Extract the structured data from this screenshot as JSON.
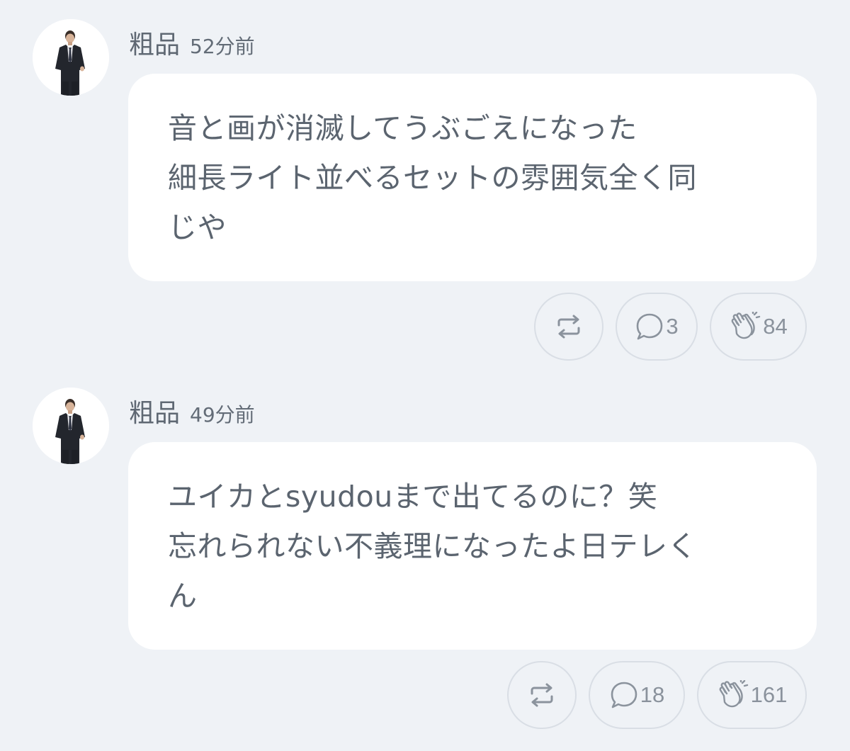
{
  "posts": [
    {
      "author": "粗品",
      "time": "52分前",
      "lines": [
        "音と画が消滅してうぶごえになった",
        "細長ライト並べるセットの雰囲気全く同",
        "じや"
      ],
      "actions": {
        "repost_icon": "repost-icon",
        "reply_icon": "speech-bubble-icon",
        "reply_count": "3",
        "clap_icon": "clap-icon",
        "clap_count": "84"
      }
    },
    {
      "author": "粗品",
      "time": "49分前",
      "lines": [
        "ユイカとsyudouまで出てるのに？笑",
        "忘れられない不義理になったよ日テレく",
        "ん"
      ],
      "actions": {
        "repost_icon": "repost-icon",
        "reply_icon": "speech-bubble-icon",
        "reply_count": "18",
        "clap_icon": "clap-icon",
        "clap_count": "161"
      }
    }
  ],
  "colors": {
    "background": "#eff2f6",
    "bubble": "#ffffff",
    "text": "#5b646f",
    "pill_border": "#d9dee5",
    "icon": "#8b939d"
  }
}
